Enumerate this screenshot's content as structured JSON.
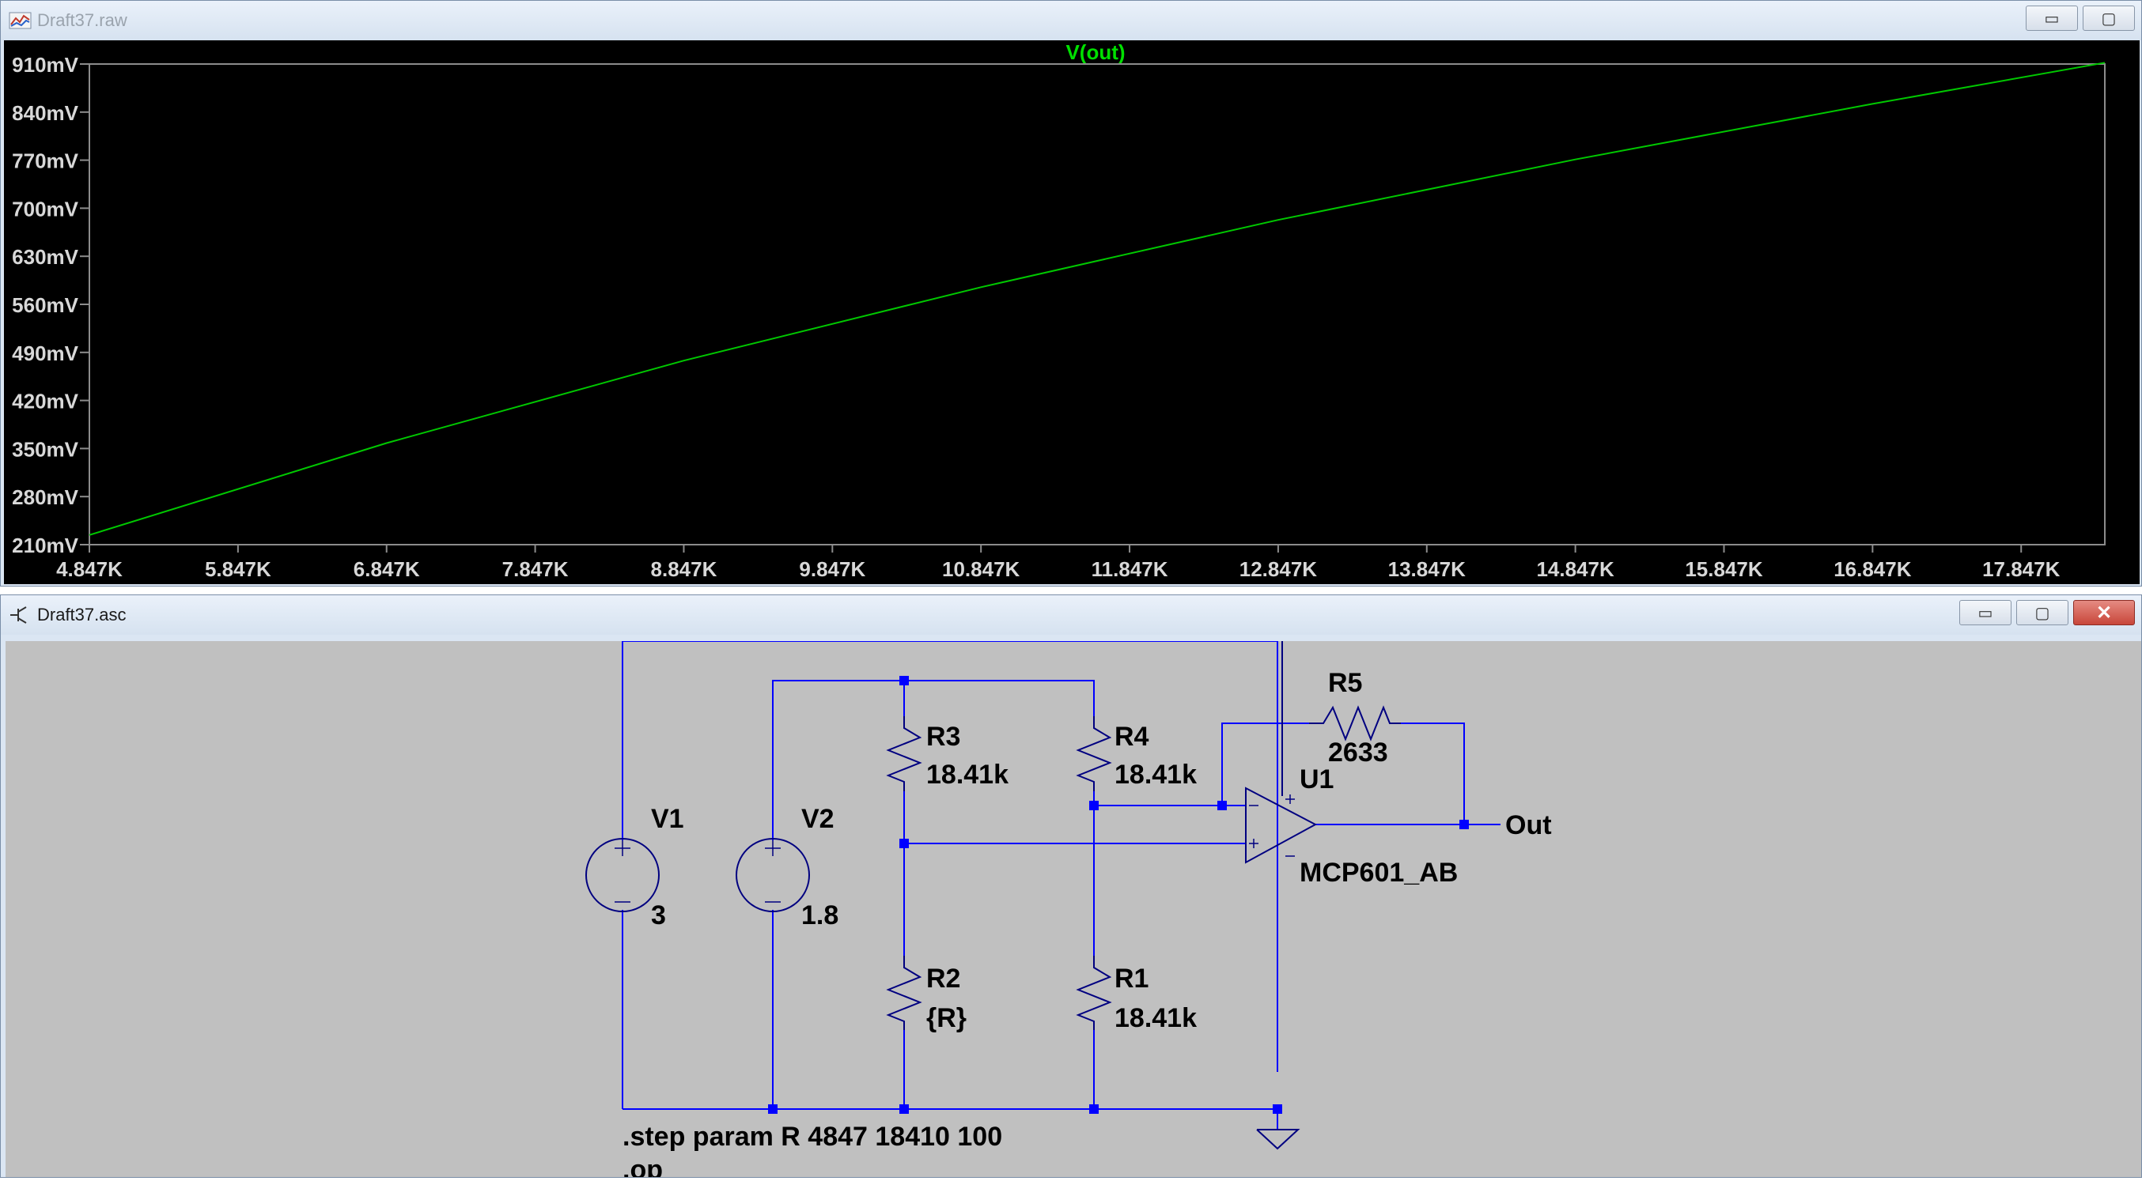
{
  "plot_window": {
    "title": "Draft37.raw",
    "buttons": {
      "minimize": "▭",
      "maximize": "▢"
    }
  },
  "schematic_window": {
    "title": "Draft37.asc",
    "buttons": {
      "minimize": "▭",
      "maximize": "▢",
      "close": "✕"
    }
  },
  "chart_data": {
    "type": "line",
    "title": "V(out)",
    "xlabel": "",
    "ylabel": "",
    "xlim": [
      4847,
      18410
    ],
    "ylim": [
      210,
      910
    ],
    "x_ticks": [
      4847,
      5847,
      6847,
      7847,
      8847,
      9847,
      10847,
      11847,
      12847,
      13847,
      14847,
      15847,
      16847,
      17847
    ],
    "x_tick_labels": [
      "4.847K",
      "5.847K",
      "6.847K",
      "7.847K",
      "8.847K",
      "9.847K",
      "10.847K",
      "11.847K",
      "12.847K",
      "13.847K",
      "14.847K",
      "15.847K",
      "16.847K",
      "17.847K"
    ],
    "y_ticks": [
      210,
      280,
      350,
      420,
      490,
      560,
      630,
      700,
      770,
      840,
      910
    ],
    "y_tick_labels": [
      "210mV",
      "280mV",
      "350mV",
      "420mV",
      "490mV",
      "560mV",
      "630mV",
      "700mV",
      "770mV",
      "840mV",
      "910mV"
    ],
    "series": [
      {
        "name": "V(out)",
        "color": "#00c800",
        "x": [
          4847,
          6847,
          8847,
          10847,
          12847,
          14847,
          16847,
          18410
        ],
        "y": [
          224,
          358,
          478,
          585,
          683,
          771,
          852,
          912
        ]
      }
    ],
    "grid": false
  },
  "schematic": {
    "components": {
      "v1": {
        "name": "V1",
        "value": "3"
      },
      "v2": {
        "name": "V2",
        "value": "1.8"
      },
      "r1": {
        "name": "R1",
        "value": "18.41k"
      },
      "r2": {
        "name": "R2",
        "value": "{R}"
      },
      "r3": {
        "name": "R3",
        "value": "18.41k"
      },
      "r4": {
        "name": "R4",
        "value": "18.41k"
      },
      "r5": {
        "name": "R5",
        "value": "2633"
      },
      "u1": {
        "name": "U1",
        "model": "MCP601_AB"
      }
    },
    "net_label": "Out",
    "directives": [
      ".step param R 4847 18410 100",
      ".op"
    ],
    "colors": {
      "wire": "#0000ff",
      "symbol": "#000080",
      "junction": "#0000ff"
    }
  }
}
